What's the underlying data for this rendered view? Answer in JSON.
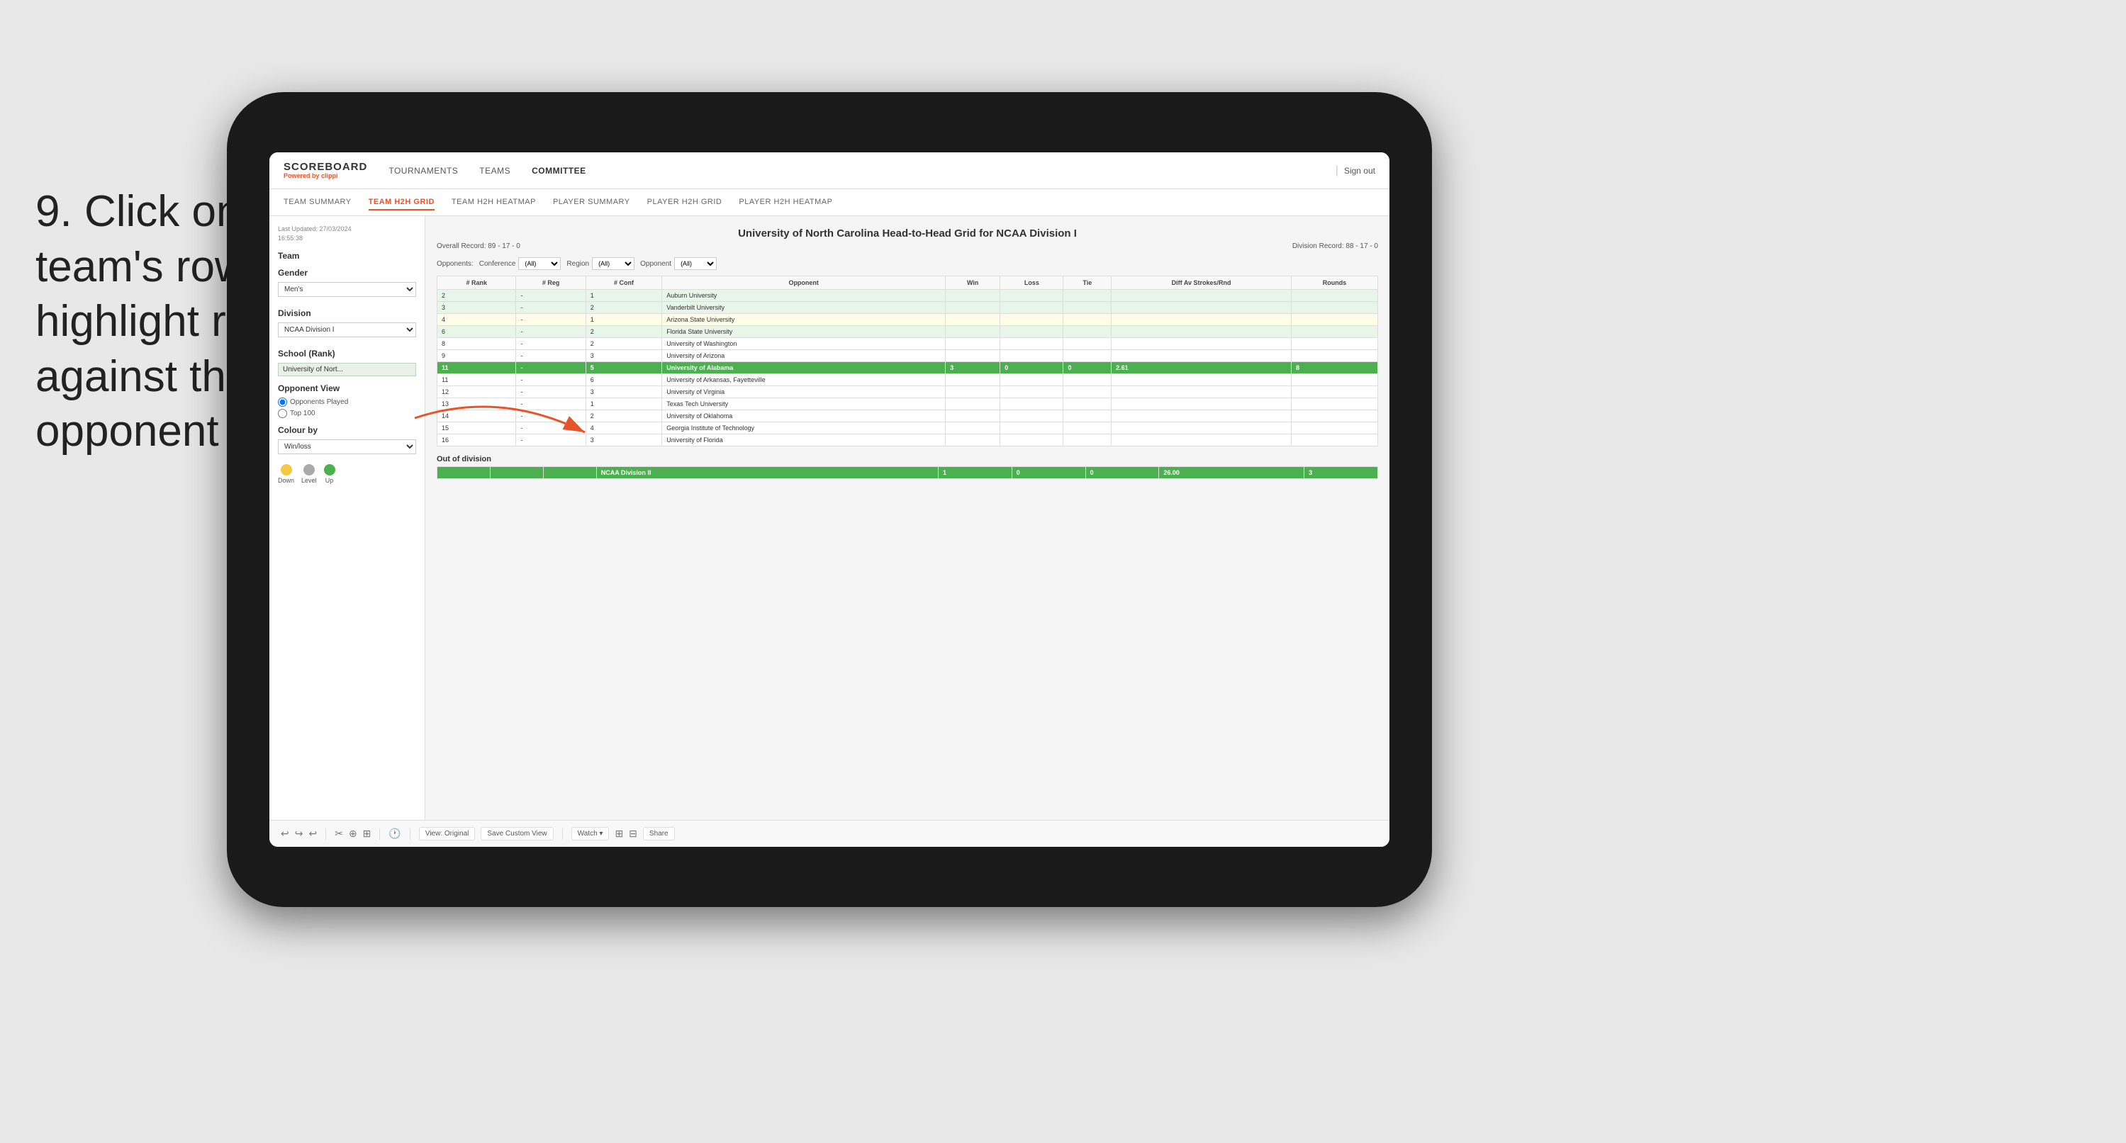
{
  "instruction": {
    "number": "9.",
    "text": "Click on a team's row to highlight results against that opponent"
  },
  "app": {
    "logo": {
      "title": "SCOREBOARD",
      "subtitle": "Powered by",
      "brand": "clippi"
    },
    "nav": {
      "items": [
        "TOURNAMENTS",
        "TEAMS",
        "COMMITTEE"
      ],
      "sign_out": "Sign out"
    },
    "sub_nav": {
      "items": [
        "TEAM SUMMARY",
        "TEAM H2H GRID",
        "TEAM H2H HEATMAP",
        "PLAYER SUMMARY",
        "PLAYER H2H GRID",
        "PLAYER H2H HEATMAP"
      ],
      "active": "TEAM H2H GRID"
    }
  },
  "left_panel": {
    "last_updated_label": "Last Updated: 27/03/2024",
    "last_updated_time": "16:55:38",
    "team_label": "Team",
    "gender_label": "Gender",
    "gender_value": "Men's",
    "division_label": "Division",
    "division_value": "NCAA Division I",
    "school_label": "School (Rank)",
    "school_value": "University of Nort...",
    "opponent_view_label": "Opponent View",
    "opponents_played_label": "Opponents Played",
    "top100_label": "Top 100",
    "colour_by_label": "Colour by",
    "colour_by_value": "Win/loss",
    "legend": {
      "down_label": "Down",
      "level_label": "Level",
      "up_label": "Up"
    }
  },
  "grid": {
    "title": "University of North Carolina Head-to-Head Grid for NCAA Division I",
    "overall_record_label": "Overall Record:",
    "overall_record": "89 - 17 - 0",
    "division_record_label": "Division Record:",
    "division_record": "88 - 17 - 0",
    "filters": {
      "conference_label": "Conference",
      "conference_value": "(All)",
      "region_label": "Region",
      "region_value": "(All)",
      "opponent_label": "Opponent",
      "opponent_value": "(All)",
      "opponents_label": "Opponents:"
    },
    "columns": [
      "# Rank",
      "# Reg",
      "# Conf",
      "Opponent",
      "Win",
      "Loss",
      "Tie",
      "Diff Av Strokes/Rnd",
      "Rounds"
    ],
    "rows": [
      {
        "rank": "2",
        "reg": "-",
        "conf": "1",
        "opponent": "Auburn University",
        "win": "",
        "loss": "",
        "tie": "",
        "diff": "",
        "rounds": "",
        "style": "light-green"
      },
      {
        "rank": "3",
        "reg": "-",
        "conf": "2",
        "opponent": "Vanderbilt University",
        "win": "",
        "loss": "",
        "tie": "",
        "diff": "",
        "rounds": "",
        "style": "light-green"
      },
      {
        "rank": "4",
        "reg": "-",
        "conf": "1",
        "opponent": "Arizona State University",
        "win": "",
        "loss": "",
        "tie": "",
        "diff": "",
        "rounds": "",
        "style": "light-yellow"
      },
      {
        "rank": "6",
        "reg": "-",
        "conf": "2",
        "opponent": "Florida State University",
        "win": "",
        "loss": "",
        "tie": "",
        "diff": "",
        "rounds": "",
        "style": "light-green"
      },
      {
        "rank": "8",
        "reg": "-",
        "conf": "2",
        "opponent": "University of Washington",
        "win": "",
        "loss": "",
        "tie": "",
        "diff": "",
        "rounds": "",
        "style": "plain"
      },
      {
        "rank": "9",
        "reg": "-",
        "conf": "3",
        "opponent": "University of Arizona",
        "win": "",
        "loss": "",
        "tie": "",
        "diff": "",
        "rounds": "",
        "style": "plain"
      },
      {
        "rank": "11",
        "reg": "-",
        "conf": "5",
        "opponent": "University of Alabama",
        "win": "3",
        "loss": "0",
        "tie": "0",
        "diff": "2.61",
        "rounds": "8",
        "style": "highlighted"
      },
      {
        "rank": "11",
        "reg": "-",
        "conf": "6",
        "opponent": "University of Arkansas, Fayetteville",
        "win": "",
        "loss": "",
        "tie": "",
        "diff": "",
        "rounds": "",
        "style": "plain"
      },
      {
        "rank": "12",
        "reg": "-",
        "conf": "3",
        "opponent": "University of Virginia",
        "win": "",
        "loss": "",
        "tie": "",
        "diff": "",
        "rounds": "",
        "style": "plain"
      },
      {
        "rank": "13",
        "reg": "-",
        "conf": "1",
        "opponent": "Texas Tech University",
        "win": "",
        "loss": "",
        "tie": "",
        "diff": "",
        "rounds": "",
        "style": "plain"
      },
      {
        "rank": "14",
        "reg": "-",
        "conf": "2",
        "opponent": "University of Oklahoma",
        "win": "",
        "loss": "",
        "tie": "",
        "diff": "",
        "rounds": "",
        "style": "plain"
      },
      {
        "rank": "15",
        "reg": "-",
        "conf": "4",
        "opponent": "Georgia Institute of Technology",
        "win": "",
        "loss": "",
        "tie": "",
        "diff": "",
        "rounds": "",
        "style": "plain"
      },
      {
        "rank": "16",
        "reg": "-",
        "conf": "3",
        "opponent": "University of Florida",
        "win": "",
        "loss": "",
        "tie": "",
        "diff": "",
        "rounds": "",
        "style": "plain"
      }
    ],
    "out_of_division_label": "Out of division",
    "out_of_division_row": {
      "division": "NCAA Division II",
      "win": "1",
      "loss": "0",
      "tie": "0",
      "diff": "26.00",
      "rounds": "3"
    }
  },
  "toolbar": {
    "undo_label": "↩",
    "redo_label": "↪",
    "view_original_label": "View: Original",
    "save_custom_label": "Save Custom View",
    "watch_label": "Watch ▾",
    "share_label": "Share"
  }
}
